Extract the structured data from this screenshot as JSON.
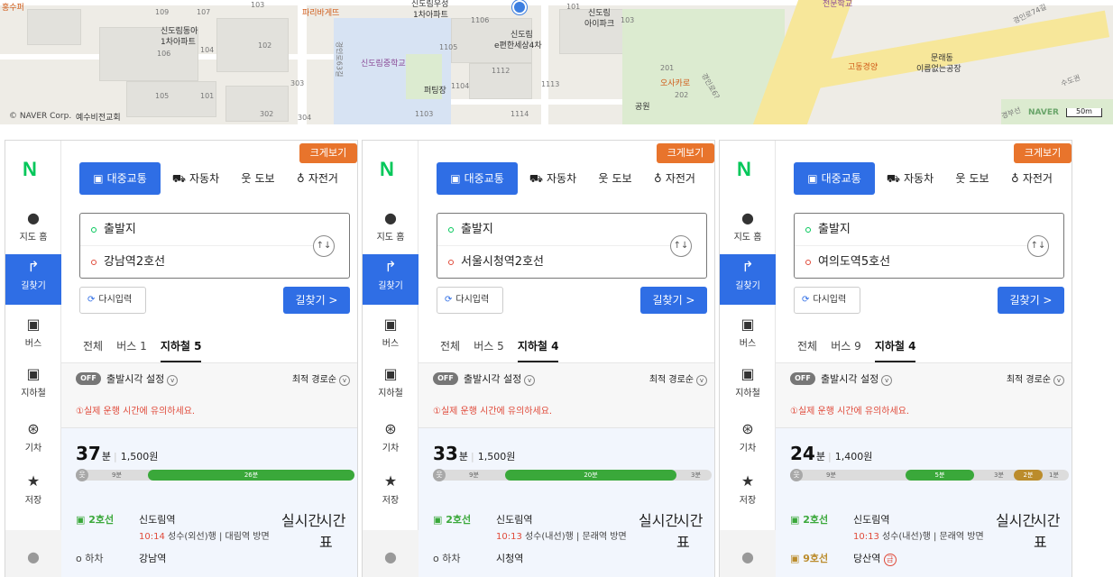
{
  "map": {
    "labels": {
      "jungsu": "홍수퍼",
      "a109": "109",
      "a107": "107",
      "a103": "103",
      "sindorimdonga": "신도림동아",
      "apt1": "1차아파트",
      "a104": "104",
      "a106": "106",
      "a102": "102",
      "paris": "파리바게뜨",
      "sindorimwoosung": "신도림우성",
      "apt1b": "1차아파트",
      "a1106": "1106",
      "a1105": "1105",
      "pinmain": "신도림",
      "pinsub": "e편한세상4차",
      "a101": "101",
      "iparkA": "신도림",
      "iparkB": "아이파크",
      "a103b": "103",
      "school": "신도림중학교",
      "a1112": "1112",
      "a1113": "1113",
      "a1104": "1104",
      "putting": "퍼팅장",
      "a201": "201",
      "osakaro": "오사카로",
      "a202": "202",
      "gongwon": "공원",
      "a303": "303",
      "a105": "105",
      "a101b": "101",
      "a302": "302",
      "a304": "304",
      "a1103": "1103",
      "a1114": "1114",
      "road63": "경인로63길",
      "roadGyeongin": "경인로6?",
      "jeonmun": "전문학교",
      "godong": "고동경양",
      "mullae": "문래동",
      "ireum": "이름없는공장",
      "roadGyeongin2": "경인로74길",
      "roadSudo": "수도권",
      "gyeongbu": "경부선",
      "copyright": "© NAVER Corp.",
      "yesu": "예수비전교회",
      "naver": "NAVER",
      "scale": "50m"
    }
  },
  "panels": [
    {
      "big_view": "크게보기",
      "logo": "N",
      "sidebar": [
        {
          "icon": "●",
          "label": "지도 홈"
        },
        {
          "icon": "↱",
          "label": "길찾기"
        },
        {
          "icon": "▣",
          "label": "버스"
        },
        {
          "icon": "▣",
          "label": "지하철"
        },
        {
          "icon": "⊛",
          "label": "기차"
        },
        {
          "icon": "★",
          "label": "저장"
        }
      ],
      "modes": [
        "대중교통",
        "자동차",
        "도보",
        "자전거"
      ],
      "start": "출발지",
      "end": "강남역2호선",
      "reset": "다시입력",
      "search": "길찾기 >",
      "tabs": [
        "전체",
        "버스 1",
        "지하철 5"
      ],
      "off": "OFF",
      "dep_time": "출발시각 설정",
      "sort": "최적 경로순",
      "warning": "①실제 운행 시간에 유의하세요.",
      "route": {
        "minutes": "37",
        "min_unit": "분",
        "fare": "1,500원",
        "bar_walk1": "9분",
        "bar_ride": "26분",
        "line": "2호선",
        "station": "신도림역",
        "realtime": "실시간",
        "timetable": "시간표",
        "dep_time": "10:14",
        "direction": "성수(외선)행 | 대림역 방면",
        "alight": "o 하차",
        "alight_station": "강남역"
      }
    },
    {
      "big_view": "크게보기",
      "logo": "N",
      "sidebar": [
        {
          "icon": "●",
          "label": "지도 홈"
        },
        {
          "icon": "↱",
          "label": "길찾기"
        },
        {
          "icon": "▣",
          "label": "버스"
        },
        {
          "icon": "▣",
          "label": "지하철"
        },
        {
          "icon": "⊛",
          "label": "기차"
        },
        {
          "icon": "★",
          "label": "저장"
        }
      ],
      "modes": [
        "대중교통",
        "자동차",
        "도보",
        "자전거"
      ],
      "start": "출발지",
      "end": "서울시청역2호선",
      "reset": "다시입력",
      "search": "길찾기 >",
      "tabs": [
        "전체",
        "버스 5",
        "지하철 4"
      ],
      "off": "OFF",
      "dep_time": "출발시각 설정",
      "sort": "최적 경로순",
      "warning": "①실제 운행 시간에 유의하세요.",
      "route": {
        "minutes": "33",
        "min_unit": "분",
        "fare": "1,500원",
        "bar_walk1": "9분",
        "bar_ride": "20분",
        "bar_walk2": "3분",
        "line": "2호선",
        "station": "신도림역",
        "realtime": "실시간",
        "timetable": "시간표",
        "dep_time": "10:13",
        "direction": "성수(내선)행 | 문래역 방면",
        "alight": "o 하차",
        "alight_station": "시청역"
      }
    },
    {
      "big_view": "크게보기",
      "logo": "N",
      "sidebar": [
        {
          "icon": "●",
          "label": "지도 홈"
        },
        {
          "icon": "↱",
          "label": "길찾기"
        },
        {
          "icon": "▣",
          "label": "버스"
        },
        {
          "icon": "▣",
          "label": "지하철"
        },
        {
          "icon": "⊛",
          "label": "기차"
        },
        {
          "icon": "★",
          "label": "저장"
        }
      ],
      "modes": [
        "대중교통",
        "자동차",
        "도보",
        "자전거"
      ],
      "start": "출발지",
      "end": "여의도역5호선",
      "reset": "다시입력",
      "search": "길찾기 >",
      "tabs": [
        "전체",
        "버스 9",
        "지하철 4"
      ],
      "off": "OFF",
      "dep_time": "출발시각 설정",
      "sort": "최적 경로순",
      "warning": "①실제 운행 시간에 유의하세요.",
      "route": {
        "minutes": "24",
        "min_unit": "분",
        "fare": "1,400원",
        "bar_walk1": "9분",
        "bar_ride": "5분",
        "bar_walk2": "3분",
        "bar_ride2": "2분",
        "bar_walk3": "1분",
        "line": "2호선",
        "station": "신도림역",
        "realtime": "실시간",
        "timetable": "시간표",
        "dep_time": "10:13",
        "direction": "성수(내선)행 | 문래역 방면",
        "transfer_line": "9호선",
        "transfer_station": "당산역",
        "transfer_badge": "급"
      }
    }
  ],
  "colors": {
    "primary": "#2f6ee5",
    "line2": "#3aa83a",
    "line9": "#bb8c2c",
    "warn": "#e04a3a",
    "bigview": "#e8742c",
    "logo": "#03c75a"
  }
}
